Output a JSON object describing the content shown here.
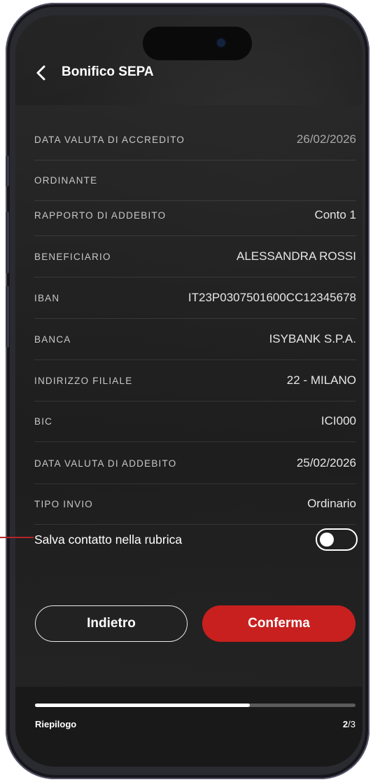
{
  "header": {
    "title": "Bonifico SEPA"
  },
  "details": [
    {
      "label": "DATA VALUTA DI ACCREDITO",
      "value": "26/02/2026",
      "dim": true
    },
    {
      "label": "ORDINANTE",
      "value": ""
    },
    {
      "label": "RAPPORTO DI ADDEBITO",
      "value": "Conto 1"
    },
    {
      "label": "BENEFICIARIO",
      "value": "ALESSANDRA  ROSSI"
    },
    {
      "label": "IBAN",
      "value": "IT23P0307501600CC12345678"
    },
    {
      "label": "BANCA",
      "value": "ISYBANK S.P.A."
    },
    {
      "label": "INDIRIZZO FILIALE",
      "value": "22 - MILANO"
    },
    {
      "label": "BIC",
      "value": "ICI000"
    },
    {
      "label": "DATA VALUTA DI ADDEBITO",
      "value": "25/02/2026"
    },
    {
      "label": "TIPO INVIO",
      "value": "Ordinario"
    }
  ],
  "save_contact": {
    "label": "Salva contatto nella rubrica",
    "enabled": false
  },
  "actions": {
    "back_label": "Indietro",
    "confirm_label": "Conferma"
  },
  "progress": {
    "step_label": "Riepilogo",
    "current": "2",
    "total": "/3",
    "fraction": 0.67
  },
  "colors": {
    "accent": "#c8201f",
    "background": "#1b1b1b"
  },
  "icons": {
    "back": "chevron-left-icon"
  }
}
